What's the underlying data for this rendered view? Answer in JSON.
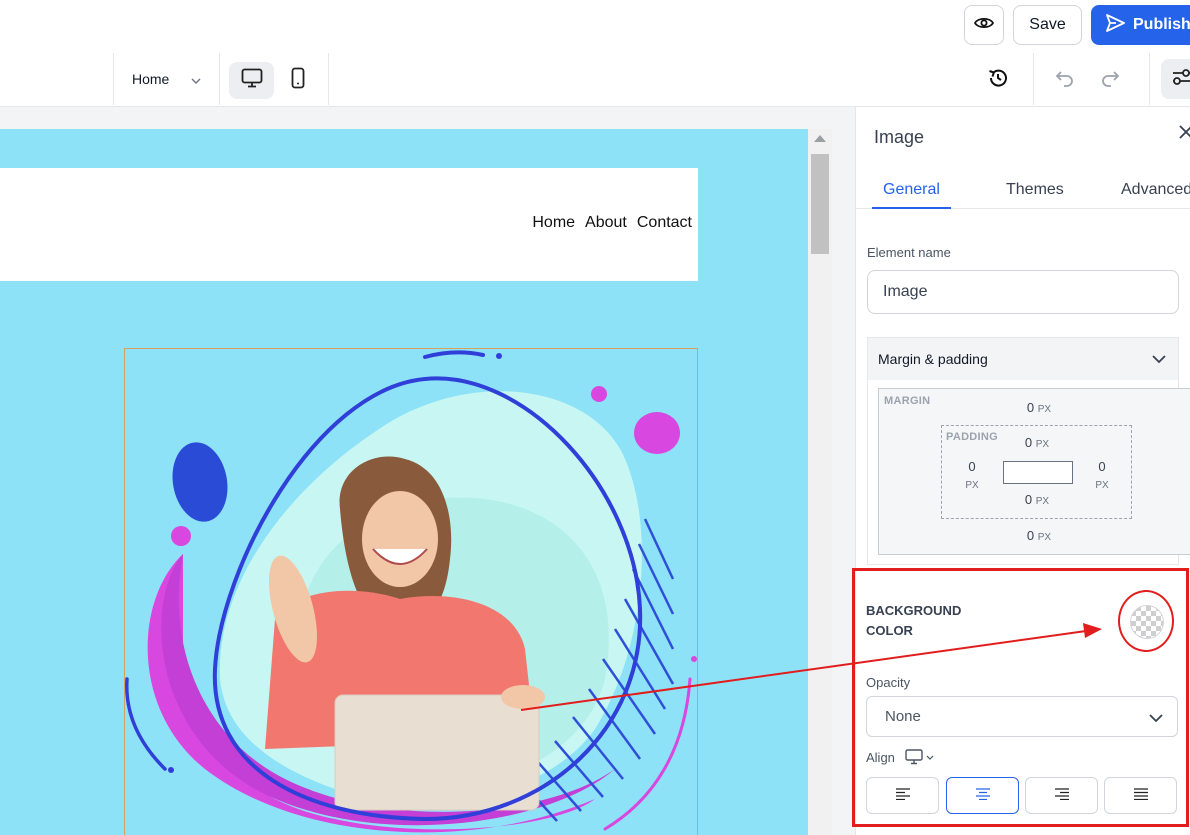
{
  "topbar": {
    "preview_icon": "eye-icon",
    "save_label": "Save",
    "publish_label": "Publish",
    "publish_icon": "send-icon"
  },
  "toolbar": {
    "page_select": "Home",
    "device_desktop_icon": "desktop-icon",
    "device_mobile_icon": "mobile-icon",
    "history_icon": "history-icon",
    "undo_icon": "undo-icon",
    "redo_icon": "redo-icon",
    "settings_icon": "sliders-icon"
  },
  "canvas": {
    "background": "#8ee2f7",
    "nav": [
      "Home",
      "About",
      "Contact"
    ]
  },
  "panel": {
    "title": "Image",
    "tabs": [
      "General",
      "Themes",
      "Advanced"
    ],
    "active_tab": "General",
    "element_name_label": "Element name",
    "element_name_value": "Image",
    "margin_padding_label": "Margin & padding",
    "margin_label": "MARGIN",
    "padding_label": "PADDING",
    "unit": "PX",
    "margin": {
      "top": "0",
      "bottom": "0"
    },
    "padding": {
      "top": "0",
      "left": "0",
      "right": "0",
      "bottom": "0"
    },
    "background_color_label": "BACKGROUND COLOR",
    "opacity_label": "Opacity",
    "opacity_value": "None",
    "align_label": "Align",
    "align_options": [
      "left",
      "center",
      "right",
      "justify"
    ],
    "align_active": "center"
  },
  "colors": {
    "accent": "#2563eb",
    "highlight": "#e11d1d"
  }
}
